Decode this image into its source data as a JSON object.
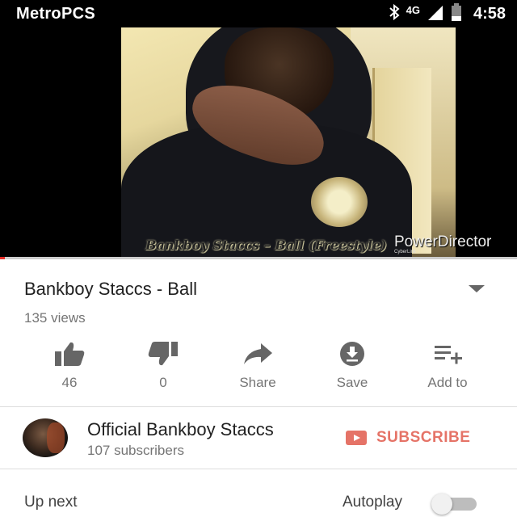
{
  "status_bar": {
    "carrier": "MetroPCS",
    "network": "4G",
    "time": "4:58",
    "icons": [
      "bluetooth-icon",
      "signal-icon",
      "battery-icon"
    ]
  },
  "video": {
    "overlay_title": "Bankboy Staccs – Ball (Freestyle)",
    "watermark_credit": "CyberLink",
    "watermark_brand": "PowerDirector",
    "progress_percent": 1
  },
  "details": {
    "title": "Bankboy Staccs - Ball",
    "views": "135 views"
  },
  "actions": [
    {
      "icon": "thumbs-up-icon",
      "label": "46"
    },
    {
      "icon": "thumbs-down-icon",
      "label": "0"
    },
    {
      "icon": "share-icon",
      "label": "Share"
    },
    {
      "icon": "download-icon",
      "label": "Save"
    },
    {
      "icon": "playlist-add-icon",
      "label": "Add to"
    }
  ],
  "channel": {
    "name": "Official Bankboy Staccs",
    "subscribers": "107 subscribers",
    "subscribe_label": "SUBSCRIBE"
  },
  "footer": {
    "up_next": "Up next",
    "autoplay": "Autoplay",
    "autoplay_on": false
  },
  "colors": {
    "accent": "#e52d27",
    "subscribe": "#e57367",
    "icon_gray": "#666666",
    "text_secondary": "#757575"
  }
}
